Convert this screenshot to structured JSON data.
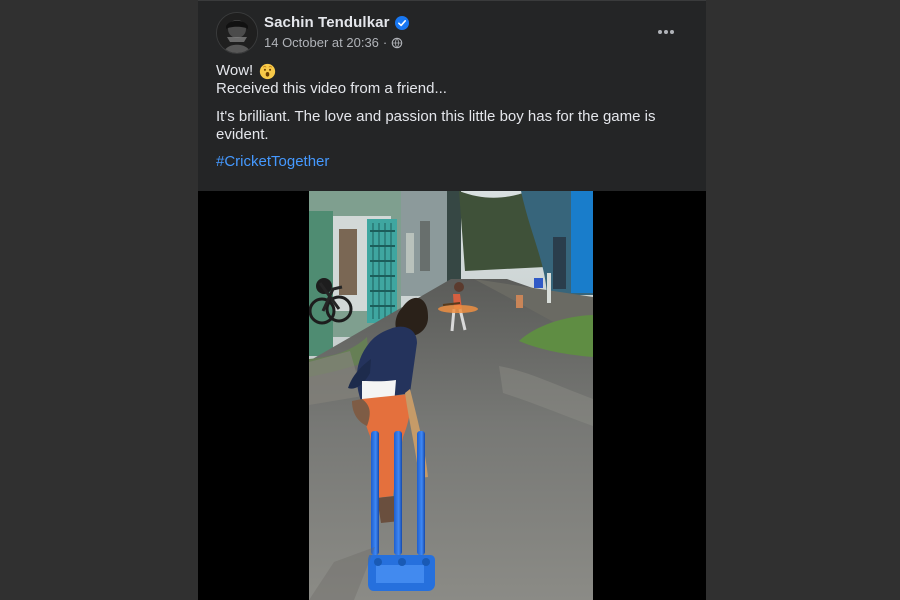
{
  "post": {
    "author": "Sachin Tendulkar",
    "timestamp": "14 October at 20:36",
    "separator": "·",
    "verified": true,
    "text": {
      "line1": "Wow!",
      "line2": "Received this video from a friend...",
      "line3": "It's brilliant. The love and passion this little boy has for the game is evident.",
      "hashtag": "#CricketTogether"
    },
    "icons": {
      "avatar": "avatar",
      "verified": "verified-badge-icon",
      "audience": "globe-icon",
      "more": "more-options-icon",
      "emoji": "astonished-face-emoji"
    },
    "colors": {
      "background": "#303030",
      "card": "#242526",
      "text": "#e4e6eb",
      "secondary_text": "#b0b3b8",
      "hashtag": "#4599ff",
      "verified": "#1877f2"
    }
  }
}
